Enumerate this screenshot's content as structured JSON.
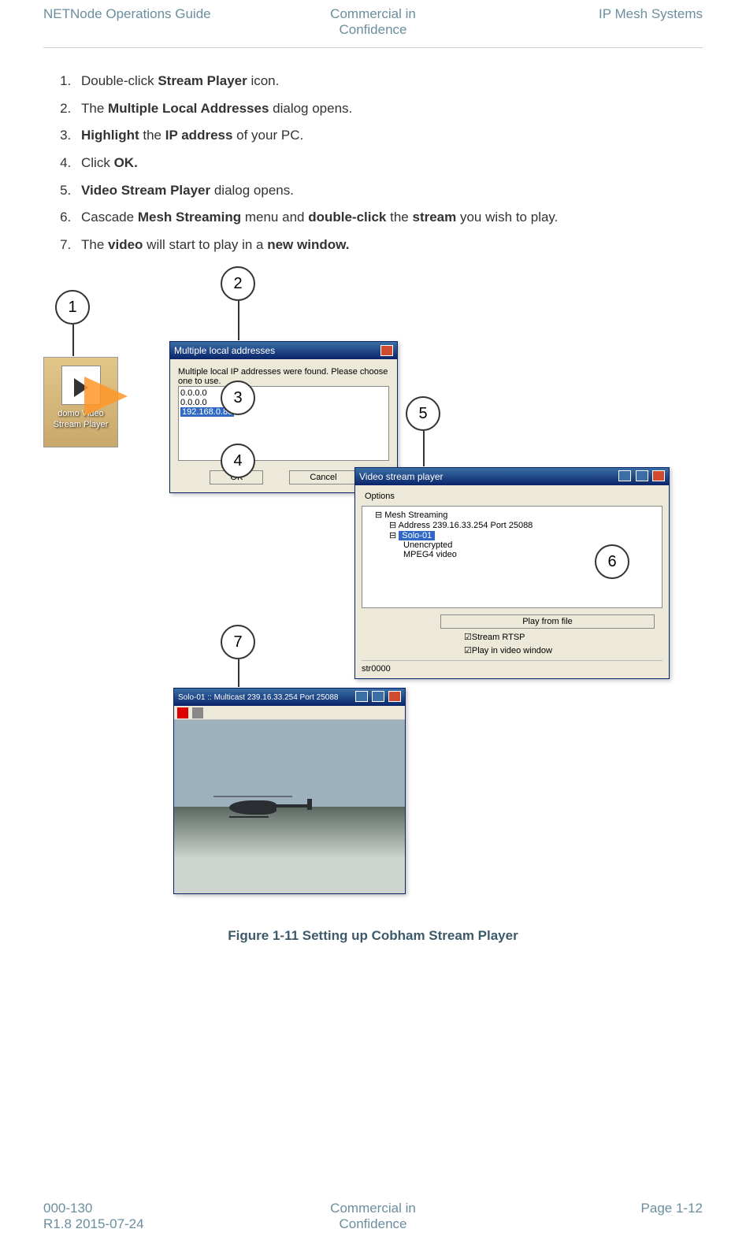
{
  "header": {
    "left": "NETNode Operations Guide",
    "center_line1": "Commercial in",
    "center_line2": "Confidence",
    "right": "IP Mesh Systems"
  },
  "steps": {
    "s1_a": "Double-click ",
    "s1_b": "Stream Player",
    "s1_c": " icon.",
    "s2_a": "The ",
    "s2_b": "Multiple Local Addresses",
    "s2_c": " dialog opens.",
    "s3_a": "Highlight",
    "s3_b": " the ",
    "s3_c": "IP address",
    "s3_d": " of your PC.",
    "s4_a": "Click ",
    "s4_b": "OK.",
    "s5_a": "Video Stream Player",
    "s5_b": " dialog opens.",
    "s6_a": "Cascade ",
    "s6_b": "Mesh Streaming",
    "s6_c": " menu and ",
    "s6_d": "double-click",
    "s6_e": " the ",
    "s6_f": "stream",
    "s6_g": " you wish to play.",
    "s7_a": "The ",
    "s7_b": "video",
    "s7_c": " will start to play in a ",
    "s7_d": "new window."
  },
  "callouts": {
    "c1": "1",
    "c2": "2",
    "c3": "3",
    "c4": "4",
    "c5": "5",
    "c6": "6",
    "c7": "7"
  },
  "desktop_icon_label_line1": "domo Video",
  "desktop_icon_label_line2": "Stream Player",
  "dialog1": {
    "title": "Multiple local addresses",
    "message": "Multiple local IP addresses were found. Please choose one to use.",
    "item1": "0.0.0.0",
    "item2": "0.0.0.0",
    "item3_selected": "192.168.0.88",
    "ok": "OK",
    "cancel": "Cancel"
  },
  "dialog2": {
    "title": "Video stream player",
    "options_label": "Options",
    "tree_root": "Mesh Streaming",
    "tree_addr": "Address 239.16.33.254  Port 25088",
    "tree_solo": "Solo-01",
    "tree_un": "Unencrypted",
    "tree_mpeg": "MPEG4 video",
    "play_button": "Play from file",
    "chk_rtsp": "Stream RTSP",
    "chk_play": "Play in video window",
    "stream_name": "str0000"
  },
  "dialog3": {
    "title": "Solo-01 :: Multicast 239.16.33.254  Port 25088"
  },
  "caption": "Figure 1-11 Setting up Cobham Stream Player",
  "footer": {
    "left_line1": "000-130",
    "left_line2": "R1.8 2015-07-24",
    "center_line1": "Commercial in",
    "center_line2": "Confidence",
    "right": "Page 1-12"
  }
}
